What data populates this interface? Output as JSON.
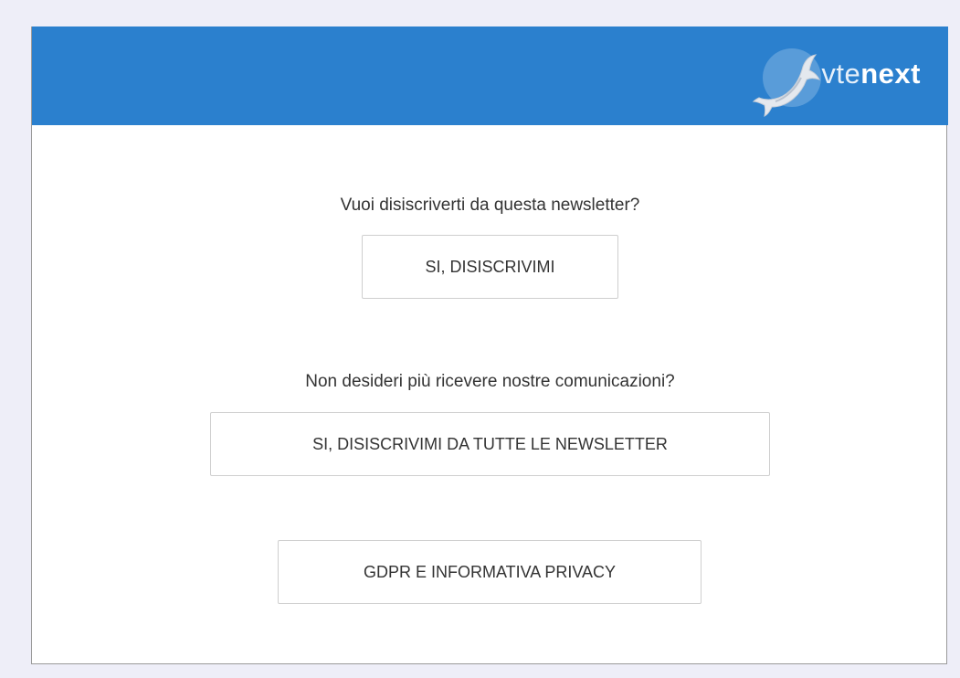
{
  "brand": {
    "logo_icon": "dolphin-icon",
    "logo_text_light": "vte",
    "logo_text_bold": "next",
    "header_color": "#2b80ce"
  },
  "unsubscribe": {
    "question": "Vuoi disiscriverti da questa newsletter?",
    "button_label": "SI, DISISCRIVIMI"
  },
  "unsubscribe_all": {
    "question": "Non desideri più ricevere nostre comunicazioni?",
    "button_label": "SI, DISISCRIVIMI DA TUTTE LE NEWSLETTER"
  },
  "privacy": {
    "button_label": "GDPR E INFORMATIVA PRIVACY"
  }
}
